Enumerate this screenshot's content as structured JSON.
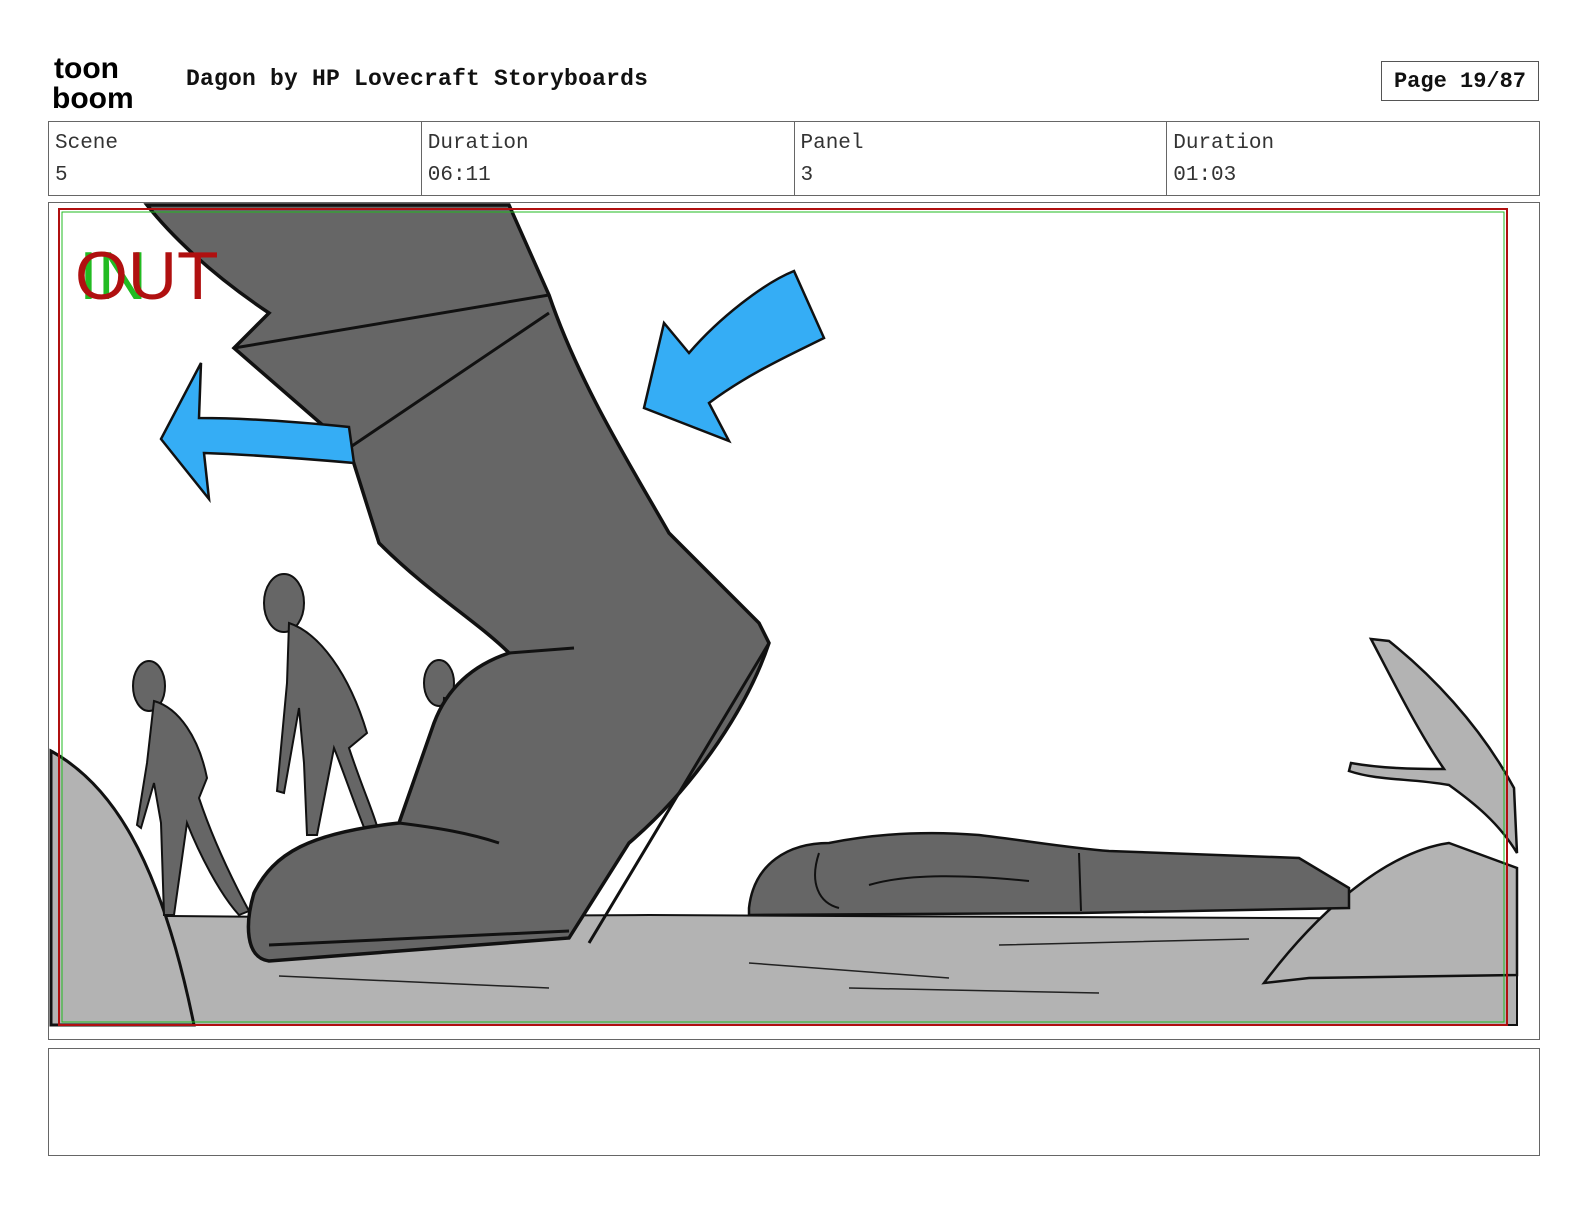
{
  "header": {
    "logo_text_top": "toon",
    "logo_text_bottom": "boom",
    "title": "Dagon by HP Lovecraft Storyboards",
    "page": "Page 19/87"
  },
  "info": {
    "scene_label": "Scene",
    "scene_value": "5",
    "duration_label": "Duration",
    "duration_value": "06:11",
    "panel_label": "Panel",
    "panel_value": "3",
    "panel_duration_label": "Duration",
    "panel_duration_value": "01:03"
  },
  "frame": {
    "in_marker": "IN",
    "out_marker": "OUT",
    "colors": {
      "arrow": "#35adf5",
      "boot": "#666666",
      "ground": "#b3b3b3",
      "out_marker": "#b01010",
      "in_marker": "#22bb22"
    }
  },
  "notes": {
    "text": ""
  }
}
